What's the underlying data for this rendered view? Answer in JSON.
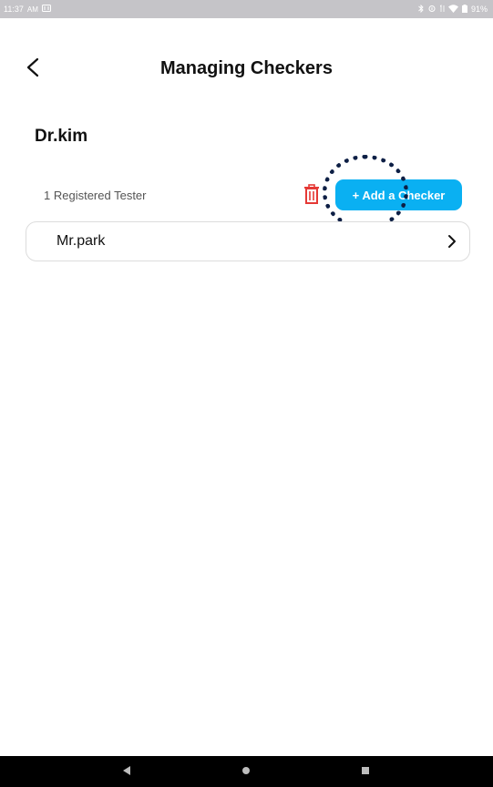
{
  "status_bar": {
    "time": "11:37",
    "ampm": "AM",
    "battery": "91%"
  },
  "header": {
    "title": "Managing Checkers"
  },
  "owner": {
    "name": "Dr.kim"
  },
  "testers": {
    "count_label": "1 Registered Tester",
    "add_button_label": "+ Add a Checker"
  },
  "checkers": [
    {
      "name": "Mr.park"
    }
  ],
  "colors": {
    "accent": "#0ab0f2",
    "delete": "#e53935",
    "highlight": "#0d1f45"
  }
}
